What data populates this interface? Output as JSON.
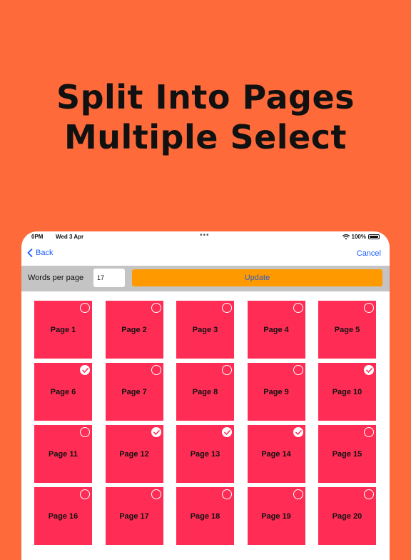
{
  "promo": {
    "line1": "Split Into Pages",
    "line2": "Multiple Select"
  },
  "status_bar": {
    "time": "0PM",
    "date": "Wed 3 Apr",
    "dots": "•••",
    "battery": "100%"
  },
  "nav": {
    "back_label": "Back",
    "cancel_label": "Cancel"
  },
  "toolbar": {
    "words_label": "Words per page",
    "words_value": "17",
    "update_label": "Update"
  },
  "colors": {
    "background": "#ff6a3a",
    "tile": "#ff2d55",
    "update_button": "#ff9900",
    "link": "#1a5cff"
  },
  "pages": [
    {
      "label": "Page 1",
      "selected": false
    },
    {
      "label": "Page 2",
      "selected": false
    },
    {
      "label": "Page 3",
      "selected": false
    },
    {
      "label": "Page 4",
      "selected": false
    },
    {
      "label": "Page 5",
      "selected": false
    },
    {
      "label": "Page 6",
      "selected": true
    },
    {
      "label": "Page 7",
      "selected": false
    },
    {
      "label": "Page 8",
      "selected": false
    },
    {
      "label": "Page 9",
      "selected": false
    },
    {
      "label": "Page 10",
      "selected": true
    },
    {
      "label": "Page 11",
      "selected": false
    },
    {
      "label": "Page 12",
      "selected": true
    },
    {
      "label": "Page 13",
      "selected": true
    },
    {
      "label": "Page 14",
      "selected": true
    },
    {
      "label": "Page 15",
      "selected": false
    },
    {
      "label": "Page 16",
      "selected": false
    },
    {
      "label": "Page 17",
      "selected": false
    },
    {
      "label": "Page 18",
      "selected": false
    },
    {
      "label": "Page 19",
      "selected": false
    },
    {
      "label": "Page 20",
      "selected": false
    }
  ]
}
